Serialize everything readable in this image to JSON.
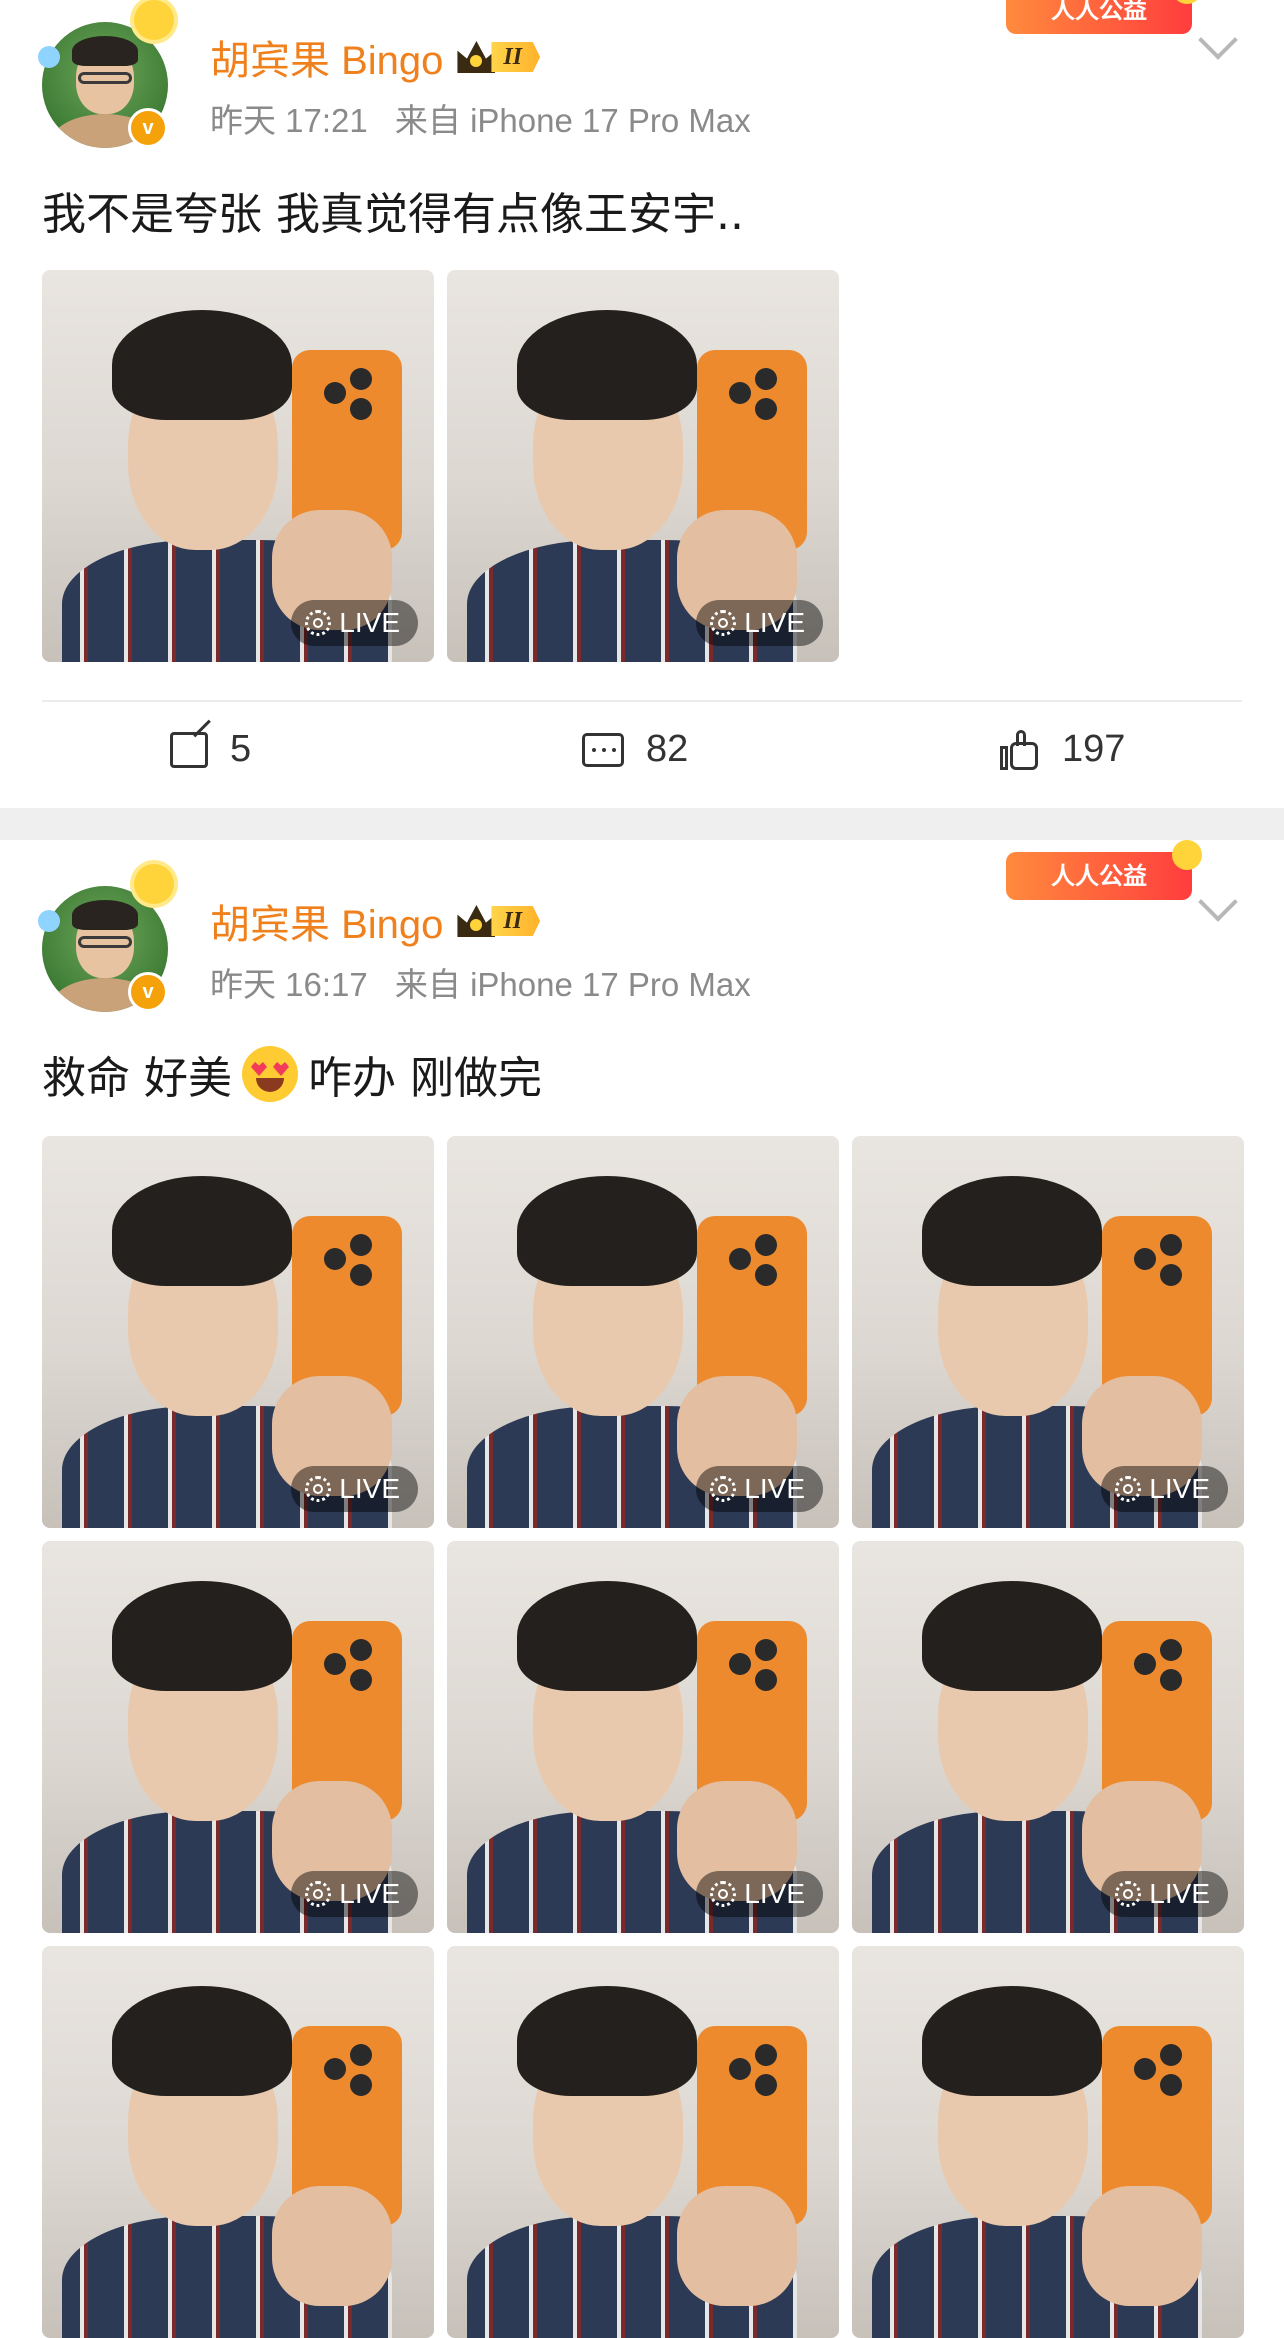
{
  "posts": [
    {
      "username": "胡宾果 Bingo",
      "level": "II",
      "badge": "人人公益",
      "time": "昨天 17:21",
      "source": "来自 iPhone 17 Pro Max",
      "text": "我不是夸张 我真觉得有点像王安宇..",
      "photos": [
        {
          "live": "LIVE"
        },
        {
          "live": "LIVE"
        }
      ],
      "actions": {
        "reposts": "5",
        "comments": "82",
        "likes": "197"
      }
    },
    {
      "username": "胡宾果 Bingo",
      "level": "II",
      "badge": "人人公益",
      "time": "昨天 16:17",
      "source": "来自 iPhone 17 Pro Max",
      "text_before": "救命 好美",
      "text_after": "咋办 刚做完",
      "emoji": "heart-eyes-emoji",
      "photos": [
        {
          "live": "LIVE"
        },
        {
          "live": "LIVE"
        },
        {
          "live": "LIVE"
        },
        {
          "live": "LIVE"
        },
        {
          "live": "LIVE"
        },
        {
          "live": "LIVE"
        },
        {
          "live": ""
        },
        {
          "live": ""
        },
        {
          "live": ""
        }
      ]
    }
  ],
  "colors": {
    "username": "#f0801c",
    "meta": "#8a8a8a",
    "divider": "#efefef"
  }
}
